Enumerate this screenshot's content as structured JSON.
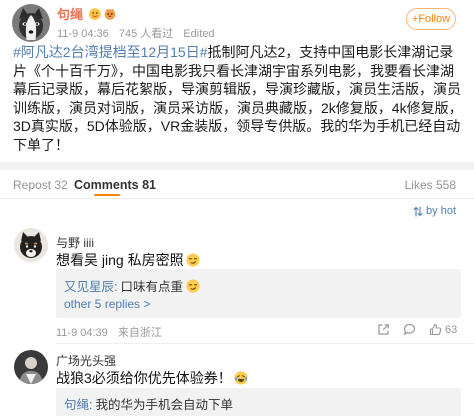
{
  "post": {
    "author": {
      "name": "句绳",
      "avatar_icon": "dog-avatar-icon",
      "badges": [
        "user-badge-icon",
        "user-badge-icon"
      ]
    },
    "time": "11-9 04:36",
    "views": "745 人看过",
    "edited": "Edited",
    "follow_label": "+Follow",
    "hashtag": "#阿凡达2台湾提档至12月15日#",
    "body": "抵制阿凡达2，支持中国电影长津湖记录片《个十百千万》，中国电影我只看长津湖宇宙系列电影，我要看长津湖幕后记录版，幕后花絮版，导演剪辑版，导演珍藏版，演员生活版，演员训练版，演员对词版，演员采访版，演员典藏版，2k修复版，4k修复版，3D真实版，5D体验版，VR金装版，领导专供版。我的华为手机已经自动下单了！"
  },
  "tabs": [
    {
      "label": "Repost",
      "count": "32",
      "active": false
    },
    {
      "label": "Comments",
      "count": "81",
      "active": true
    },
    {
      "label": "Likes",
      "count": "558",
      "active": false
    }
  ],
  "sort": {
    "label": "by hot",
    "icon": "sort-icon"
  },
  "comments": [
    {
      "author": "与野 iiii",
      "avatar_icon": "dog-cartoon-avatar-icon",
      "text": "想看吴 jing 私房密照",
      "emoji": "smirk-emoji-icon",
      "reply": {
        "author": "又见星辰:",
        "text": "口味有点重",
        "emoji": "smirk-emoji-icon"
      },
      "more_replies": "other 5 replies >",
      "time": "11-9 04:39",
      "location": "来自浙江",
      "actions": [
        "share-icon",
        "comment-icon",
        "like-icon"
      ],
      "likes": "63"
    },
    {
      "author": "广场光头强",
      "avatar_icon": "person-avatar-icon",
      "text": "战狼3必须给你优先体验券！",
      "emoji": "laughing-emoji-icon",
      "reply": {
        "author": "句绳:",
        "text": "我的华为手机会自动下单"
      }
    }
  ],
  "colors": {
    "author_name": "#eb7350",
    "follow_accent": "#ff8200",
    "link_blue": "#507daf",
    "meta_gray": "#999999",
    "separator": "#f2f2f2",
    "active_tab_underline": "#ff8200"
  }
}
